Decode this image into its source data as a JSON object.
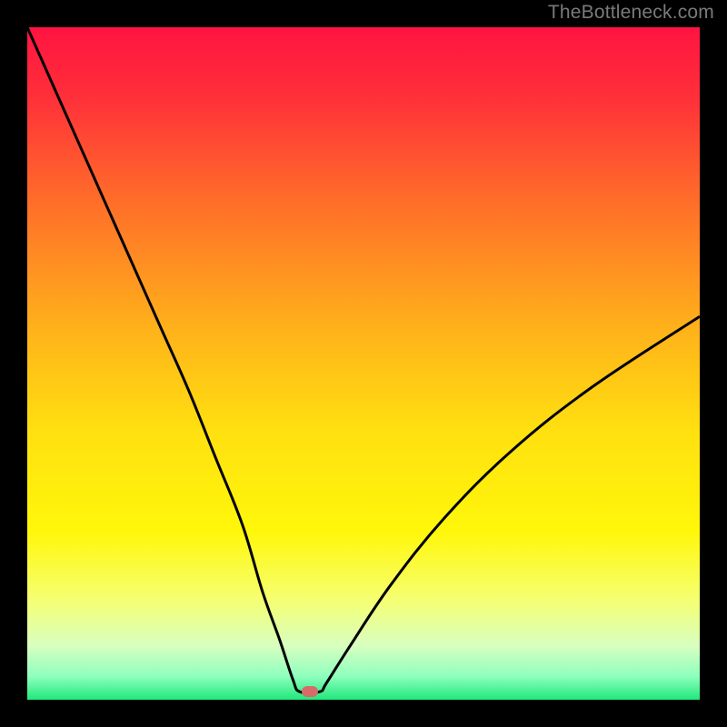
{
  "watermark": {
    "text": "TheBottleneck.com"
  },
  "chart_data": {
    "type": "line",
    "title": "",
    "xlabel": "",
    "ylabel": "",
    "xlim": [
      0,
      100
    ],
    "ylim": [
      0,
      100
    ],
    "grid": false,
    "legend": false,
    "line_color": "#000000",
    "gradient_stops": [
      {
        "offset": 0.0,
        "color": "#ff1440"
      },
      {
        "offset": 0.1,
        "color": "#ff2e3a"
      },
      {
        "offset": 0.25,
        "color": "#ff6a2a"
      },
      {
        "offset": 0.45,
        "color": "#ffb21a"
      },
      {
        "offset": 0.6,
        "color": "#ffe010"
      },
      {
        "offset": 0.75,
        "color": "#fff70a"
      },
      {
        "offset": 0.85,
        "color": "#f6ff70"
      },
      {
        "offset": 0.92,
        "color": "#d8ffc0"
      },
      {
        "offset": 0.965,
        "color": "#8effbe"
      },
      {
        "offset": 1.0,
        "color": "#20e87a"
      }
    ],
    "series": [
      {
        "name": "bottleneck-curve",
        "x": [
          0.0,
          4.0,
          8.0,
          12.0,
          16.0,
          20.0,
          24.0,
          28.0,
          32.0,
          35.0,
          37.5,
          39.5,
          40.5,
          43.5,
          44.5,
          48.0,
          54.0,
          62.0,
          72.0,
          84.0,
          100.0
        ],
        "y": [
          100.0,
          91.0,
          82.0,
          73.0,
          64.0,
          55.0,
          46.0,
          36.0,
          26.0,
          16.0,
          9.0,
          3.0,
          1.2,
          1.2,
          2.5,
          8.0,
          17.0,
          27.0,
          37.0,
          46.5,
          57.0
        ]
      }
    ],
    "marker": {
      "x": 42.0,
      "y": 1.2,
      "color": "#d86a6a"
    }
  }
}
